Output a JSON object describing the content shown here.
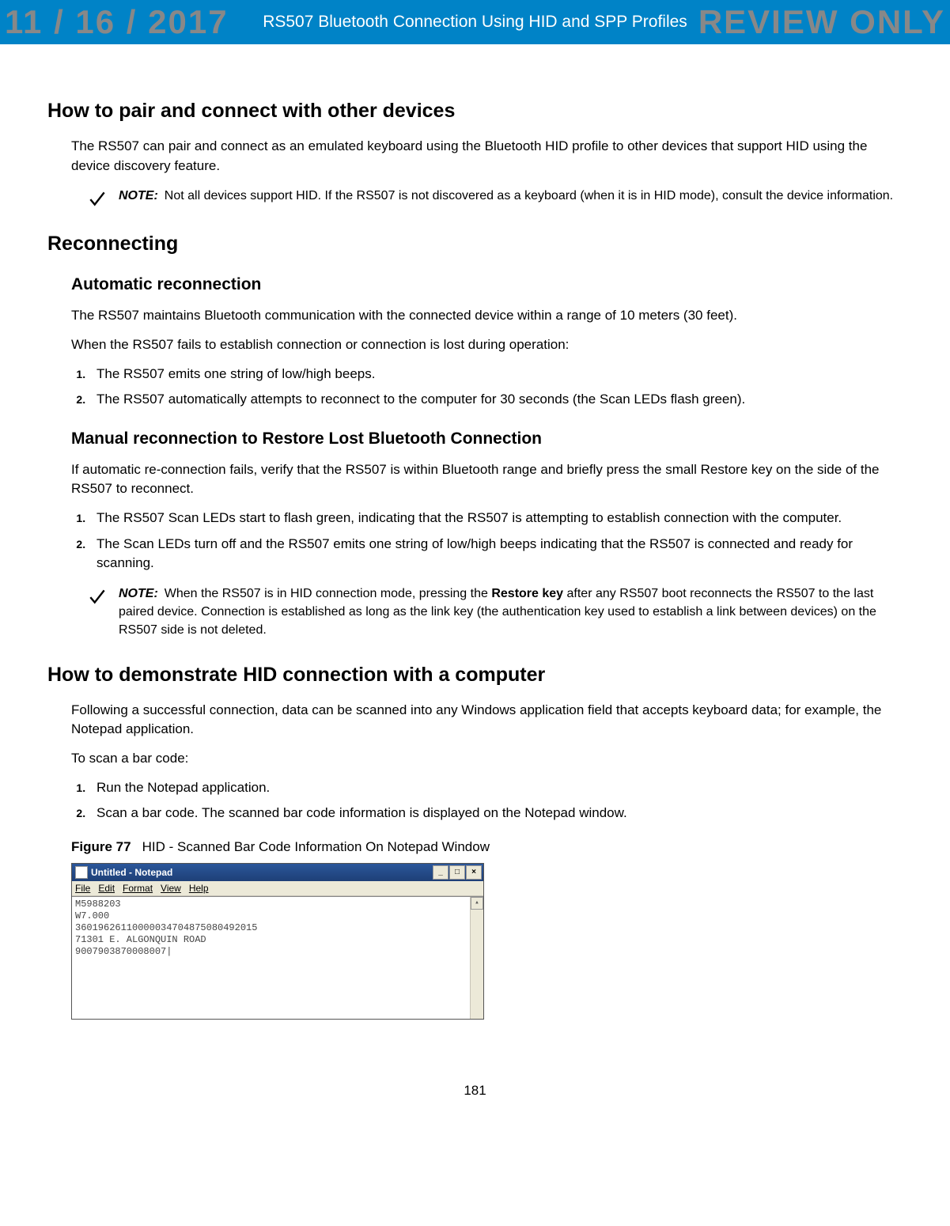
{
  "watermark": {
    "date": "11 / 16 / 2017",
    "label": "REVIEW ONLY"
  },
  "header": {
    "title": "RS507 Bluetooth Connection Using HID and SPP Profiles"
  },
  "section_pair": {
    "title": "How to pair and connect with other devices",
    "text": "The RS507 can pair and connect as an emulated keyboard using the Bluetooth HID profile to other devices that support HID using the device discovery feature.",
    "note_label": "NOTE:",
    "note_text": "Not all devices support HID. If the RS507 is not discovered as a keyboard (when it is in HID mode), consult the device information."
  },
  "section_reconnect": {
    "title": "Reconnecting",
    "auto": {
      "title": "Automatic reconnection",
      "p1": "The RS507 maintains Bluetooth communication with the connected device within a range of 10 meters (30 feet).",
      "p2": "When the RS507 fails to establish connection or connection is lost during operation:",
      "steps": [
        "The RS507 emits one string of low/high beeps.",
        "The RS507 automatically attempts to reconnect to the computer for 30 seconds (the Scan LEDs flash green)."
      ]
    },
    "manual": {
      "title": "Manual reconnection to Restore Lost Bluetooth Connection",
      "p1": "If automatic re-connection fails, verify that the RS507 is within Bluetooth range and briefly press the small Restore key on the side of the RS507 to reconnect.",
      "steps": [
        "The RS507 Scan LEDs start to flash green, indicating that the RS507 is attempting to establish connection with the computer.",
        "The Scan LEDs turn off and the RS507 emits one string of low/high beeps indicating that the RS507 is connected and ready for scanning."
      ],
      "note_label": "NOTE:",
      "note_text_pre": "When the RS507 is in HID connection mode, pressing the ",
      "note_bold": "Restore key",
      "note_text_post": " after any RS507 boot reconnects the RS507 to the last paired device. Connection is established as long as the link key (the authentication key used to establish a link between devices) on the RS507 side is not deleted."
    }
  },
  "section_demo": {
    "title": "How to demonstrate HID connection with a computer",
    "p1": "Following a successful connection, data can be scanned into any Windows application field that accepts keyboard data; for example, the Notepad application.",
    "p2": "To scan a bar code:",
    "steps": [
      "Run the Notepad application.",
      "Scan a bar code. The scanned bar code information is displayed on the Notepad window."
    ],
    "figure_label": "Figure 77",
    "figure_caption": "HID - Scanned Bar Code Information On Notepad Window"
  },
  "notepad": {
    "title": "Untitled - Notepad",
    "menu": [
      "File",
      "Edit",
      "Format",
      "View",
      "Help"
    ],
    "content": "M5988203\nW7.000\n36019626110000034704875080492015\n71301 E. ALGONQUIN ROAD\n9007903870008007|"
  },
  "page_number": "181"
}
